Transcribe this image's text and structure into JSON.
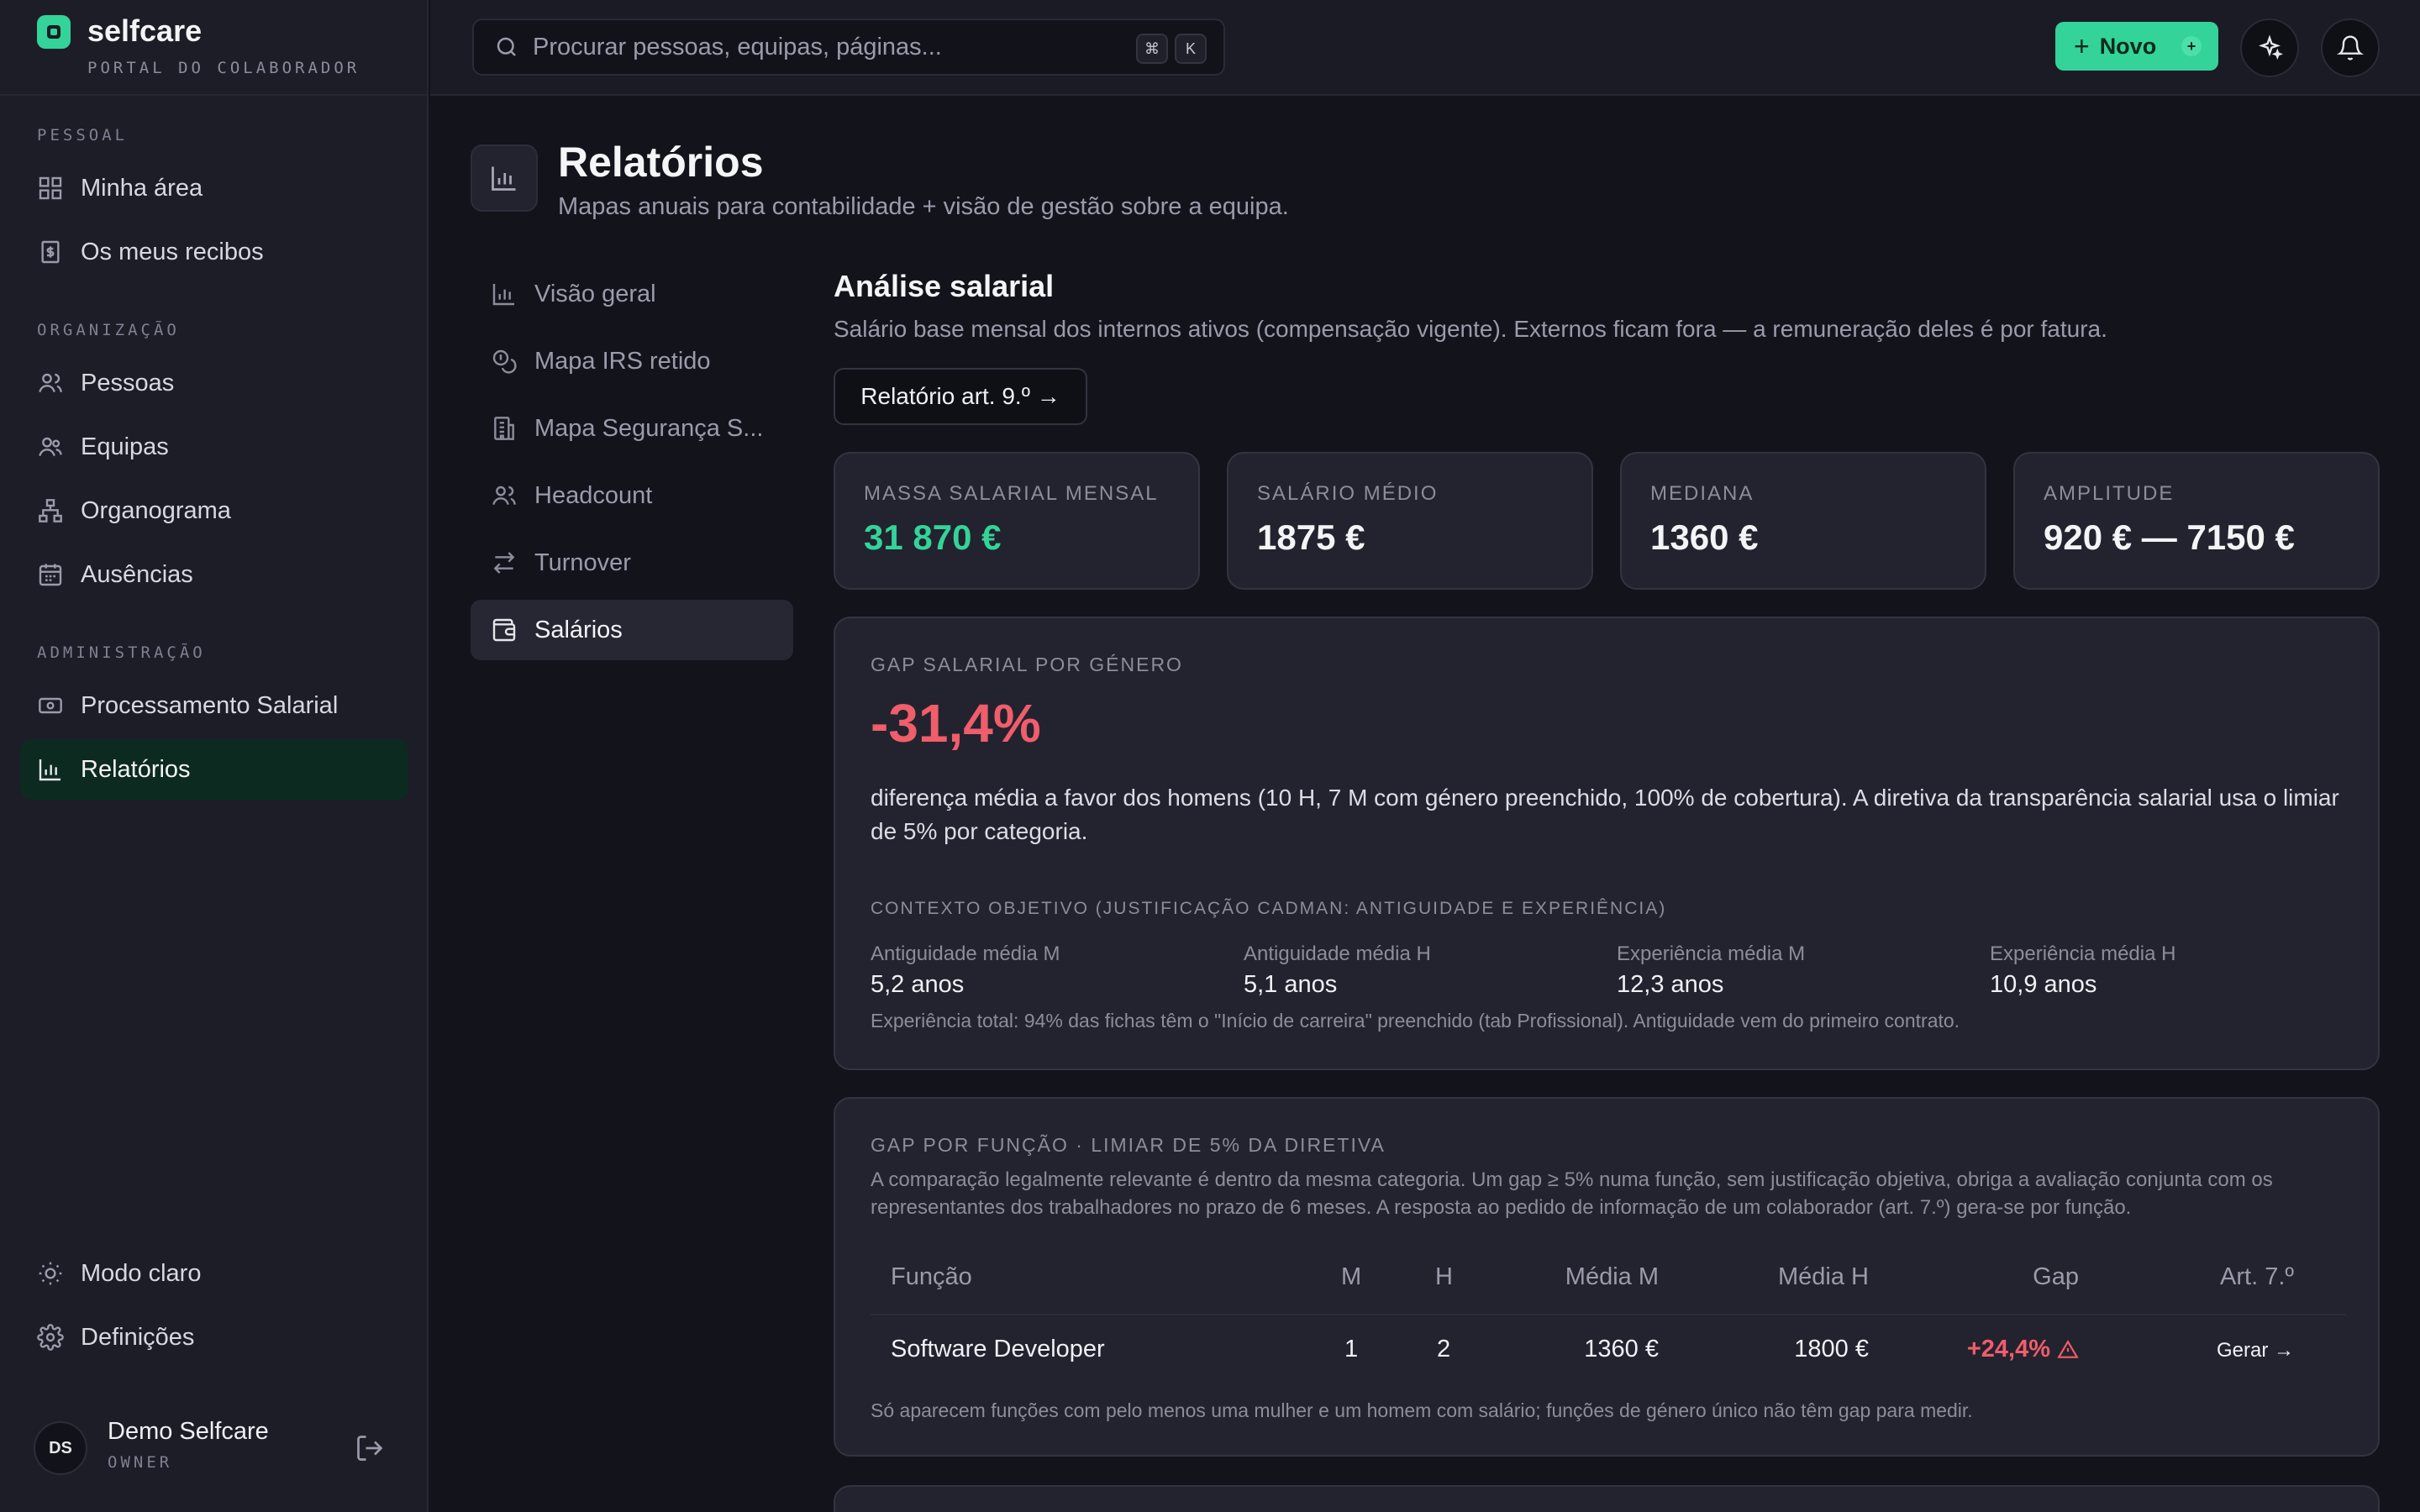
{
  "brand": {
    "name": "selfcare",
    "subtitle": "PORTAL DO COLABORADOR"
  },
  "sidebar": {
    "sections": [
      {
        "label": "PESSOAL"
      },
      {
        "label": "ORGANIZAÇÃO"
      },
      {
        "label": "ADMINISTRAÇÃO"
      }
    ],
    "items": [
      {
        "label": "Minha área",
        "icon": "dashboard-icon"
      },
      {
        "label": "Os meus recibos",
        "icon": "receipt-icon"
      },
      {
        "label": "Pessoas",
        "icon": "people-icon"
      },
      {
        "label": "Equipas",
        "icon": "team-icon"
      },
      {
        "label": "Organograma",
        "icon": "org-chart-icon"
      },
      {
        "label": "Ausências",
        "icon": "calendar-icon"
      },
      {
        "label": "Processamento Salarial",
        "icon": "banknote-icon"
      },
      {
        "label": "Relatórios",
        "icon": "bar-chart-icon",
        "active": true
      }
    ],
    "footer": [
      {
        "label": "Modo claro",
        "icon": "sun-icon"
      },
      {
        "label": "Definições",
        "icon": "gear-icon"
      }
    ],
    "user": {
      "initials": "DS",
      "name": "Demo Selfcare",
      "role": "OWNER"
    }
  },
  "topbar": {
    "search_placeholder": "Procurar pessoas, equipas, páginas...",
    "shortcut": [
      "⌘",
      "K"
    ],
    "new_label": "Novo",
    "new_badge": "+"
  },
  "page": {
    "title": "Relatórios",
    "subtitle": "Mapas anuais para contabilidade + visão de gestão sobre a equipa."
  },
  "subnav": [
    {
      "label": "Visão geral",
      "icon": "bar-chart-icon"
    },
    {
      "label": "Mapa IRS retido",
      "icon": "coins-icon"
    },
    {
      "label": "Mapa Segurança S...",
      "icon": "building-icon"
    },
    {
      "label": "Headcount",
      "icon": "people-icon"
    },
    {
      "label": "Turnover",
      "icon": "arrows-swap-icon"
    },
    {
      "label": "Salários",
      "icon": "wallet-icon",
      "active": true
    }
  ],
  "section": {
    "title": "Análise salarial",
    "description": "Salário base mensal dos internos ativos (compensação vigente). Externos ficam fora — a remuneração deles é por fatura.",
    "report_button": "Relatório art. 9.º →"
  },
  "kpis": [
    {
      "label": "MASSA SALARIAL MENSAL",
      "value": "31 870 €",
      "accent": "#34d399"
    },
    {
      "label": "SALÁRIO MÉDIO",
      "value": "1875 €"
    },
    {
      "label": "MEDIANA",
      "value": "1360 €"
    },
    {
      "label": "AMPLITUDE",
      "value": "920 € — 7150 €"
    }
  ],
  "gender_gap": {
    "caption": "GAP SALARIAL POR GÉNERO",
    "value": "-31,4%",
    "description": "diferença média a favor dos homens (10 H, 7 M com género preenchido, 100% de cobertura). A diretiva da transparência salarial usa o limiar de 5% por categoria.",
    "context_caption": "CONTEXTO OBJETIVO (JUSTIFICAÇÃO CADMAN: ANTIGUIDADE E EXPERIÊNCIA)",
    "context": [
      {
        "label": "Antiguidade média M",
        "value": "5,2 anos"
      },
      {
        "label": "Antiguidade média H",
        "value": "5,1 anos"
      },
      {
        "label": "Experiência média M",
        "value": "12,3 anos"
      },
      {
        "label": "Experiência média H",
        "value": "10,9 anos"
      }
    ],
    "note": "Experiência total: 94% das fichas têm o \"Início de carreira\" preenchido (tab Profissional). Antiguidade vem do primeiro contrato."
  },
  "function_gap": {
    "caption": "GAP POR FUNÇÃO · LIMIAR DE 5% DA DIRETIVA",
    "description": "A comparação legalmente relevante é dentro da mesma categoria. Um gap ≥ 5% numa função, sem justificação objetiva, obriga a avaliação conjunta com os representantes dos trabalhadores no prazo de 6 meses. A resposta ao pedido de informação de um colaborador (art. 7.º) gera-se por função.",
    "columns": [
      "Função",
      "M",
      "H",
      "Média M",
      "Média H",
      "Gap",
      "Art. 7.º"
    ],
    "rows": [
      {
        "funcao": "Software Developer",
        "m": "1",
        "h": "2",
        "media_m": "1360 €",
        "media_h": "1800 €",
        "gap": "+24,4%",
        "action": "Gerar →"
      }
    ],
    "note": "Só aparecem funções com pelo menos uma mulher e um homem com salário; funções de género único não têm gap para medir."
  },
  "colors": {
    "accent": "#34d399",
    "danger": "#f05d6b",
    "background": "#13131b",
    "card": "#22232e"
  }
}
